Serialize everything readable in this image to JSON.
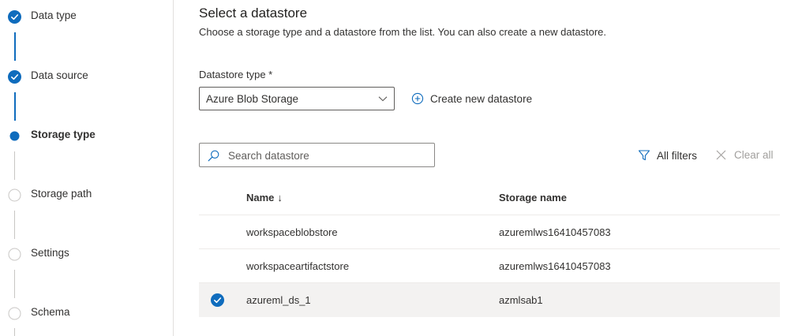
{
  "stepper": {
    "steps": [
      {
        "label": "Data type",
        "state": "done"
      },
      {
        "label": "Data source",
        "state": "done"
      },
      {
        "label": "Storage type",
        "state": "active"
      },
      {
        "label": "Storage path",
        "state": "todo"
      },
      {
        "label": "Settings",
        "state": "todo"
      },
      {
        "label": "Schema",
        "state": "todo"
      }
    ]
  },
  "main": {
    "title": "Select a datastore",
    "subtitle": "Choose a storage type and a datastore from the list. You can also create a new datastore.",
    "datastore_type": {
      "label": "Datastore type *",
      "value": "Azure Blob Storage"
    },
    "create_new_label": "Create new datastore",
    "search": {
      "placeholder": "Search datastore",
      "value": ""
    },
    "all_filters_label": "All filters",
    "clear_all_label": "Clear all",
    "table": {
      "columns": [
        {
          "label": "Name",
          "sort": "↓"
        },
        {
          "label": "Storage name"
        }
      ],
      "rows": [
        {
          "name": "workspaceblobstore",
          "storage_name": "azuremlws16410457083",
          "selected": false
        },
        {
          "name": "workspaceartifactstore",
          "storage_name": "azuremlws16410457083",
          "selected": false
        },
        {
          "name": "azureml_ds_1",
          "storage_name": "azmlsab1",
          "selected": true
        }
      ]
    }
  },
  "colors": {
    "accent": "#0f6cbd",
    "text": "#323130",
    "border": "#8a8886",
    "selected_row": "#f3f2f1",
    "disabled_text": "#a19f9d"
  }
}
